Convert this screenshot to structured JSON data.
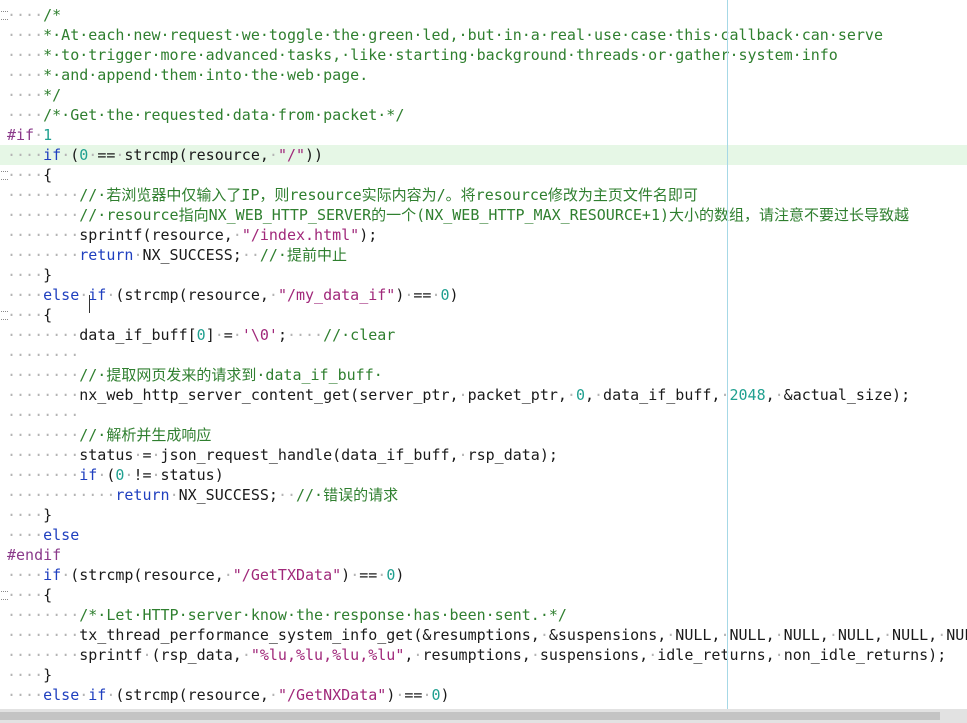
{
  "colors": {
    "background": "#ffffff",
    "keyword": "#1f3fbf",
    "comment": "#2f7f2f",
    "string": "#a0287a",
    "number": "#20a090",
    "preprocessor": "#8a3a8a",
    "current_line": "#e6f7e6",
    "edge_guide": "#a6d8e6"
  },
  "current_line": 7,
  "lines": [
    [
      [
        "ws",
        "····"
      ],
      [
        "cm",
        "/*"
      ]
    ],
    [
      [
        "ws",
        "····"
      ],
      [
        "cm",
        "*·At·each·new·request·we·toggle·the·green·led,·but·in·a·real·use·case·this·callback·can·serve"
      ]
    ],
    [
      [
        "ws",
        "····"
      ],
      [
        "cm",
        "*·to·trigger·more·advanced·tasks,·like·starting·background·threads·or·gather·system·info"
      ]
    ],
    [
      [
        "ws",
        "····"
      ],
      [
        "cm",
        "*·and·append·them·into·the·web·page."
      ]
    ],
    [
      [
        "ws",
        "····"
      ],
      [
        "cm",
        "*/"
      ]
    ],
    [
      [
        "ws",
        "····"
      ],
      [
        "cm",
        "/*·Get·the·requested·data·from·packet·*/"
      ]
    ],
    [
      [
        "pp",
        "#if"
      ],
      [
        "ws",
        "·"
      ],
      [
        "nm",
        "1"
      ]
    ],
    [
      [
        "ws",
        "····"
      ],
      [
        "kw",
        "if"
      ],
      [
        "ws",
        "·"
      ],
      [
        "p",
        "("
      ],
      [
        "nm",
        "0"
      ],
      [
        "ws",
        "·"
      ],
      [
        "p",
        "=="
      ],
      [
        "ws",
        "·"
      ],
      [
        "p",
        "strcmp(resource,"
      ],
      [
        "ws",
        "·"
      ],
      [
        "st",
        "\"/\""
      ],
      [
        "p",
        "))"
      ]
    ],
    [
      [
        "ws",
        "····"
      ],
      [
        "p",
        "{"
      ]
    ],
    [
      [
        "ws",
        "········"
      ],
      [
        "cm",
        "//·若浏览器中仅输入了IP，则resource实际内容为/。将resource修改为主页文件名即可"
      ]
    ],
    [
      [
        "ws",
        "········"
      ],
      [
        "cm",
        "//·resource指向NX_WEB_HTTP_SERVER的一个(NX_WEB_HTTP_MAX_RESOURCE+1)大小的数组，请注意不要过长导致越"
      ]
    ],
    [
      [
        "ws",
        "········"
      ],
      [
        "p",
        "sprintf(resource,"
      ],
      [
        "ws",
        "·"
      ],
      [
        "st",
        "\"/index.html\""
      ],
      [
        "p",
        ");"
      ]
    ],
    [
      [
        "ws",
        "········"
      ],
      [
        "kw",
        "return"
      ],
      [
        "ws",
        "·"
      ],
      [
        "p",
        "NX_SUCCESS;"
      ],
      [
        "ws",
        "··"
      ],
      [
        "cm",
        "//·提前中止"
      ]
    ],
    [
      [
        "ws",
        "····"
      ],
      [
        "p",
        "}"
      ]
    ],
    [
      [
        "ws",
        "····"
      ],
      [
        "kw",
        "else"
      ],
      [
        "ws",
        "·"
      ],
      [
        "kw",
        "if"
      ],
      [
        "ws",
        "·"
      ],
      [
        "p",
        "(strcmp(resource,"
      ],
      [
        "ws",
        "·"
      ],
      [
        "st",
        "\"/my_data_if\""
      ],
      [
        "p",
        ")"
      ],
      [
        "ws",
        "·"
      ],
      [
        "p",
        "=="
      ],
      [
        "ws",
        "·"
      ],
      [
        "nm",
        "0"
      ],
      [
        "p",
        ")"
      ]
    ],
    [
      [
        "ws",
        "····"
      ],
      [
        "p",
        "{"
      ]
    ],
    [
      [
        "ws",
        "········"
      ],
      [
        "p",
        "data_if_buff["
      ],
      [
        "nm",
        "0"
      ],
      [
        "p",
        "]"
      ],
      [
        "ws",
        "·"
      ],
      [
        "p",
        "="
      ],
      [
        "ws",
        "·"
      ],
      [
        "st",
        "'\\0'"
      ],
      [
        "p",
        ";"
      ],
      [
        "ws",
        "····"
      ],
      [
        "cm",
        "//·clear"
      ]
    ],
    [
      [
        "ws",
        "········"
      ]
    ],
    [
      [
        "ws",
        "········"
      ],
      [
        "cm",
        "//·提取网页发来的请求到·data_if_buff·"
      ]
    ],
    [
      [
        "ws",
        "········"
      ],
      [
        "p",
        "nx_web_http_server_content_get(server_ptr,"
      ],
      [
        "ws",
        "·"
      ],
      [
        "p",
        "packet_ptr,"
      ],
      [
        "ws",
        "·"
      ],
      [
        "nm",
        "0"
      ],
      [
        "p",
        ","
      ],
      [
        "ws",
        "·"
      ],
      [
        "p",
        "data_if_buff,"
      ],
      [
        "ws",
        "·"
      ],
      [
        "nm",
        "2048"
      ],
      [
        "p",
        ","
      ],
      [
        "ws",
        "·"
      ],
      [
        "p",
        "&actual_size);"
      ]
    ],
    [
      [
        "ws",
        "········"
      ]
    ],
    [
      [
        "ws",
        "········"
      ],
      [
        "cm",
        "//·解析并生成响应"
      ]
    ],
    [
      [
        "ws",
        "········"
      ],
      [
        "p",
        "status"
      ],
      [
        "ws",
        "·"
      ],
      [
        "p",
        "="
      ],
      [
        "ws",
        "·"
      ],
      [
        "p",
        "json_request_handle(data_if_buff,"
      ],
      [
        "ws",
        "·"
      ],
      [
        "p",
        "rsp_data);"
      ]
    ],
    [
      [
        "ws",
        "········"
      ],
      [
        "kw",
        "if"
      ],
      [
        "ws",
        "·"
      ],
      [
        "p",
        "("
      ],
      [
        "nm",
        "0"
      ],
      [
        "ws",
        "·"
      ],
      [
        "p",
        "!="
      ],
      [
        "ws",
        "·"
      ],
      [
        "p",
        "status)"
      ]
    ],
    [
      [
        "ws",
        "············"
      ],
      [
        "kw",
        "return"
      ],
      [
        "ws",
        "·"
      ],
      [
        "p",
        "NX_SUCCESS;"
      ],
      [
        "ws",
        "··"
      ],
      [
        "cm",
        "//·错误的请求"
      ]
    ],
    [
      [
        "ws",
        "····"
      ],
      [
        "p",
        "}"
      ]
    ],
    [
      [
        "ws",
        "····"
      ],
      [
        "kw",
        "else"
      ]
    ],
    [
      [
        "pp",
        "#endif"
      ]
    ],
    [
      [
        "ws",
        "····"
      ],
      [
        "kw",
        "if"
      ],
      [
        "ws",
        "·"
      ],
      [
        "p",
        "(strcmp(resource,"
      ],
      [
        "ws",
        "·"
      ],
      [
        "st",
        "\"/GetTXData\""
      ],
      [
        "p",
        ")"
      ],
      [
        "ws",
        "·"
      ],
      [
        "p",
        "=="
      ],
      [
        "ws",
        "·"
      ],
      [
        "nm",
        "0"
      ],
      [
        "p",
        ")"
      ]
    ],
    [
      [
        "ws",
        "····"
      ],
      [
        "p",
        "{"
      ]
    ],
    [
      [
        "ws",
        "········"
      ],
      [
        "cm",
        "/*·Let·HTTP·server·know·the·response·has·been·sent.·*/"
      ]
    ],
    [
      [
        "ws",
        "········"
      ],
      [
        "p",
        "tx_thread_performance_system_info_get(&resumptions,"
      ],
      [
        "ws",
        "·"
      ],
      [
        "p",
        "&suspensions,"
      ],
      [
        "ws",
        "·"
      ],
      [
        "p",
        "NULL,"
      ],
      [
        "ws",
        "·"
      ],
      [
        "p",
        "NULL,"
      ],
      [
        "ws",
        "·"
      ],
      [
        "p",
        "NULL,"
      ],
      [
        "ws",
        "·"
      ],
      [
        "p",
        "NULL,"
      ],
      [
        "ws",
        "·"
      ],
      [
        "p",
        "NULL,"
      ],
      [
        "ws",
        "·"
      ],
      [
        "p",
        "NULL"
      ]
    ],
    [
      [
        "ws",
        "········"
      ],
      [
        "p",
        "sprintf"
      ],
      [
        "ws",
        "·"
      ],
      [
        "p",
        "(rsp_data,"
      ],
      [
        "ws",
        "·"
      ],
      [
        "st",
        "\"%lu,%lu,%lu,%lu\""
      ],
      [
        "p",
        ","
      ],
      [
        "ws",
        "·"
      ],
      [
        "p",
        "resumptions,"
      ],
      [
        "ws",
        "·"
      ],
      [
        "p",
        "suspensions,"
      ],
      [
        "ws",
        "·"
      ],
      [
        "p",
        "idle_returns,"
      ],
      [
        "ws",
        "·"
      ],
      [
        "p",
        "non_idle_returns);"
      ]
    ],
    [
      [
        "ws",
        "····"
      ],
      [
        "p",
        "}"
      ]
    ],
    [
      [
        "ws",
        "····"
      ],
      [
        "kw",
        "else"
      ],
      [
        "ws",
        "·"
      ],
      [
        "kw",
        "if"
      ],
      [
        "ws",
        "·"
      ],
      [
        "p",
        "(strcmp(resource,"
      ],
      [
        "ws",
        "·"
      ],
      [
        "st",
        "\"/GetNXData\""
      ],
      [
        "p",
        ")"
      ],
      [
        "ws",
        "·"
      ],
      [
        "p",
        "=="
      ],
      [
        "ws",
        "·"
      ],
      [
        "nm",
        "0"
      ],
      [
        "p",
        ")"
      ]
    ]
  ],
  "fold_lines": [
    0,
    8,
    15,
    29
  ],
  "ui": {
    "scrollbar_icon": "horizontal-scrollbar"
  }
}
